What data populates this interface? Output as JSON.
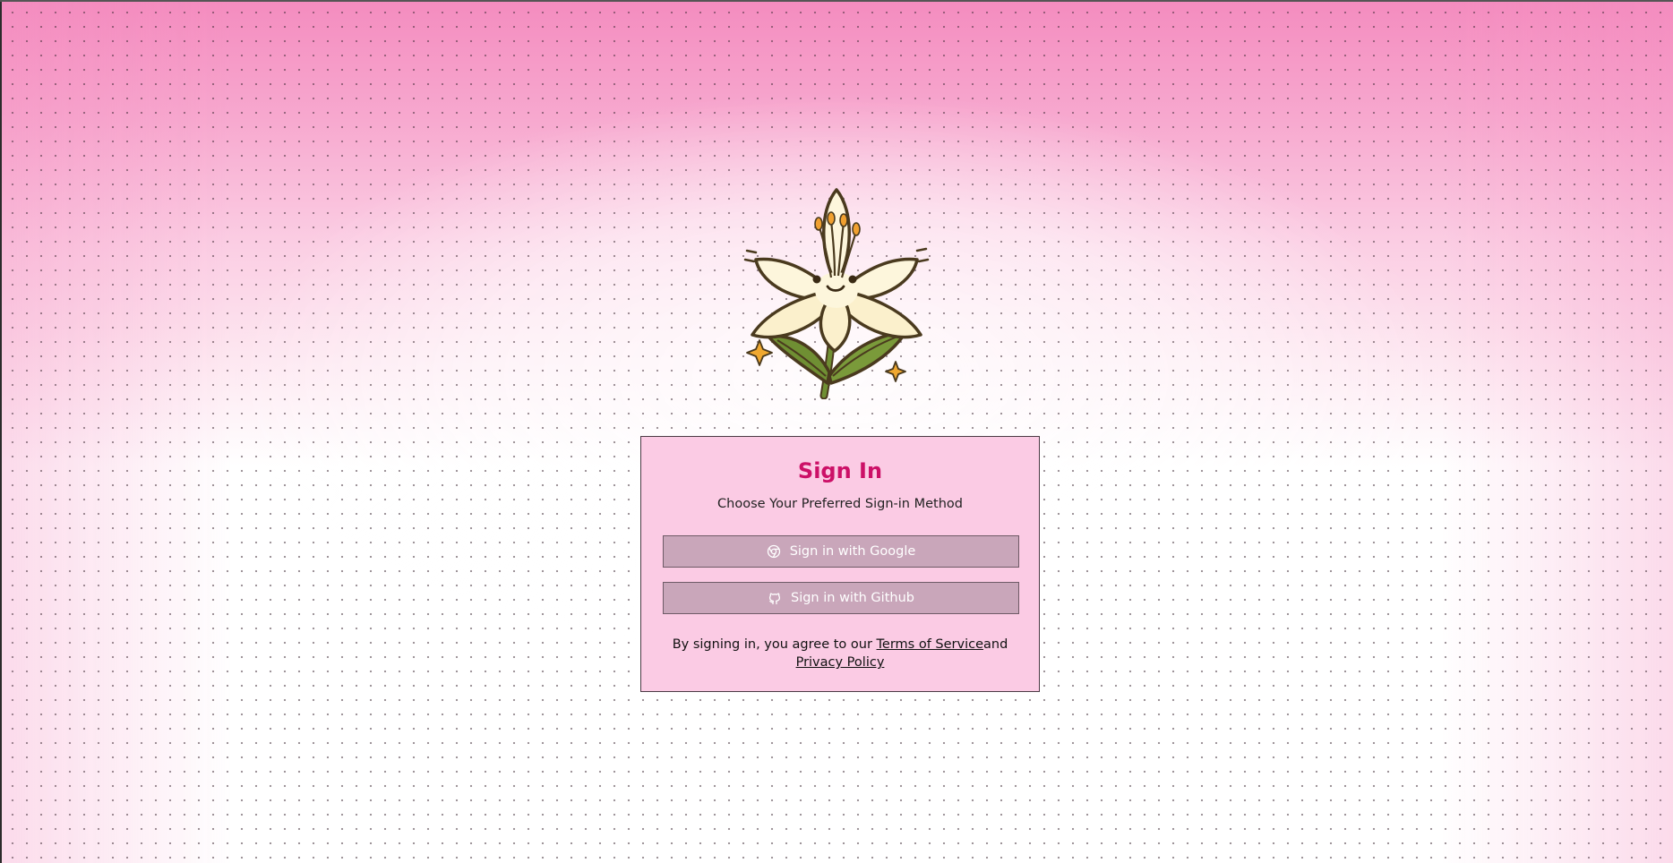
{
  "logo": {
    "icon": "lily-flower-icon"
  },
  "card": {
    "title": "Sign In",
    "subtitle": "Choose Your Preferred Sign-in Method",
    "buttons": [
      {
        "icon": "chrome-icon",
        "label": "Sign in with Google"
      },
      {
        "icon": "github-icon",
        "label": "Sign in with Github"
      }
    ],
    "legal": {
      "prefix": "By signing in, you agree to our ",
      "terms_label": "Terms of Service",
      "connector": "and",
      "privacy_label": "Privacy Policy"
    }
  },
  "colors": {
    "accent": "#cc1067",
    "card_background": "#fbcbe4",
    "button_background": "#c9a6ba",
    "background_top": "#f48cbf"
  }
}
